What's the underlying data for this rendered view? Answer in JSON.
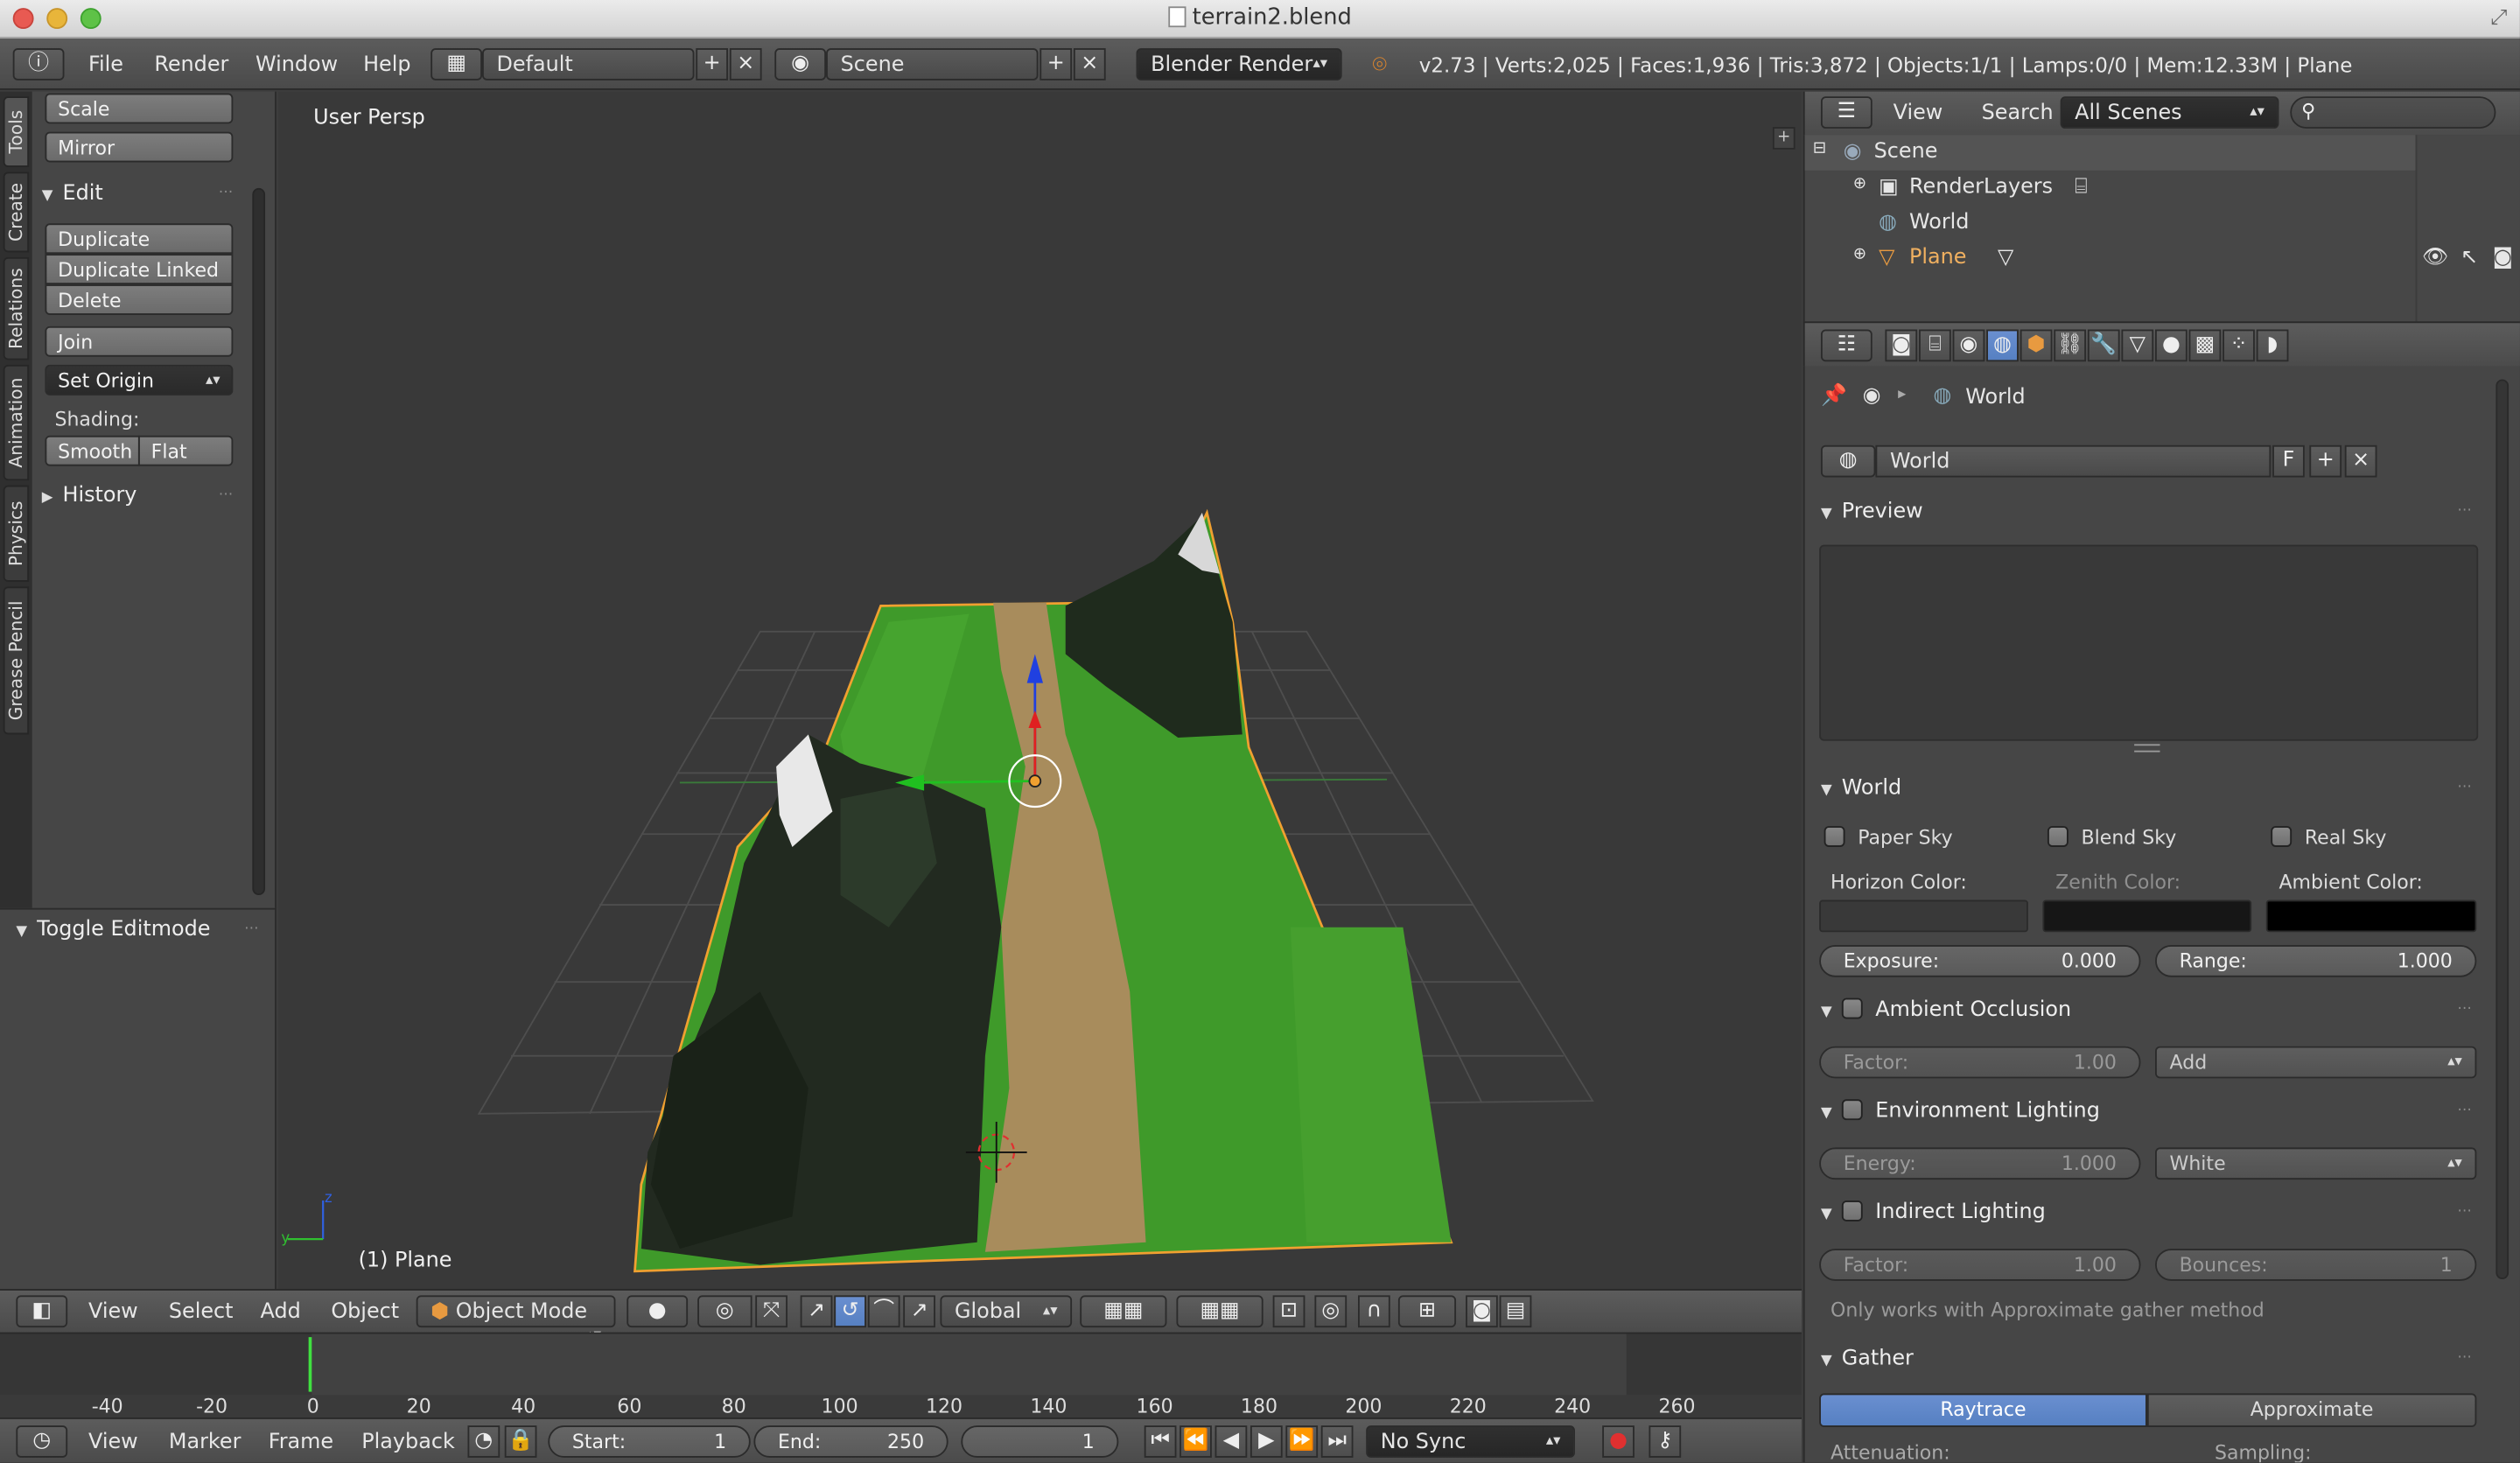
{
  "window": {
    "title": "terrain2.blend"
  },
  "menubar": {
    "items": [
      "File",
      "Render",
      "Window",
      "Help"
    ],
    "layout": "Default",
    "scene": "Scene",
    "engine": "Blender Render",
    "stats": "v2.73 | Verts:2,025 | Faces:1,936 | Tris:3,872 | Objects:1/1 | Lamps:0/0 | Mem:12.33M | Plane"
  },
  "tabs": [
    "Tools",
    "Create",
    "Relations",
    "Animation",
    "Physics",
    "Grease Pencil"
  ],
  "tools": {
    "scale": "Scale",
    "mirror": "Mirror",
    "edit_header": "Edit",
    "duplicate": "Duplicate",
    "duplicate_linked": "Duplicate Linked",
    "delete": "Delete",
    "join": "Join",
    "set_origin": "Set Origin",
    "shading_label": "Shading:",
    "smooth": "Smooth",
    "flat": "Flat",
    "history": "History",
    "toggle_editmode": "Toggle Editmode"
  },
  "viewport": {
    "persp_label": "User Persp",
    "object_label": "(1) Plane"
  },
  "vpheader": {
    "menus": [
      "View",
      "Select",
      "Add",
      "Object"
    ],
    "mode": "Object Mode",
    "orientation": "Global"
  },
  "timeline": {
    "ticks": [
      -40,
      -20,
      0,
      20,
      40,
      60,
      80,
      100,
      120,
      140,
      160,
      180,
      200,
      220,
      240,
      260
    ],
    "menus": [
      "View",
      "Marker",
      "Frame",
      "Playback"
    ],
    "start_label": "Start:",
    "start": "1",
    "end_label": "End:",
    "end": "250",
    "current": "1",
    "sync": "No Sync"
  },
  "outliner": {
    "menus": [
      "View",
      "Search"
    ],
    "filter": "All Scenes",
    "items": [
      "Scene",
      "RenderLayers",
      "World",
      "Plane"
    ]
  },
  "properties": {
    "breadcrumb": "World",
    "datablock": "World",
    "fake_user": "F",
    "preview_header": "Preview",
    "world_header": "World",
    "paper_sky": "Paper Sky",
    "blend_sky": "Blend Sky",
    "real_sky": "Real Sky",
    "horizon_color": "Horizon Color:",
    "zenith_color": "Zenith Color:",
    "ambient_color": "Ambient Color:",
    "exposure_label": "Exposure:",
    "exposure": "0.000",
    "range_label": "Range:",
    "range": "1.000",
    "ao_header": "Ambient Occlusion",
    "ao_factor_label": "Factor:",
    "ao_factor": "1.00",
    "ao_blend": "Add",
    "env_header": "Environment Lighting",
    "env_energy_label": "Energy:",
    "env_energy": "1.000",
    "env_color": "White",
    "indirect_header": "Indirect Lighting",
    "ind_factor_label": "Factor:",
    "ind_factor": "1.00",
    "bounces_label": "Bounces:",
    "bounces": "1",
    "note": "Only works with Approximate gather method",
    "gather_header": "Gather",
    "raytrace": "Raytrace",
    "approximate": "Approximate",
    "attenuation": "Attenuation:",
    "sampling": "Sampling:"
  },
  "colors": {
    "accent": "#5680c2",
    "terrain_green": "#3f9a2a",
    "path": "#a88c5c",
    "selection_outline": "#f0a030"
  }
}
